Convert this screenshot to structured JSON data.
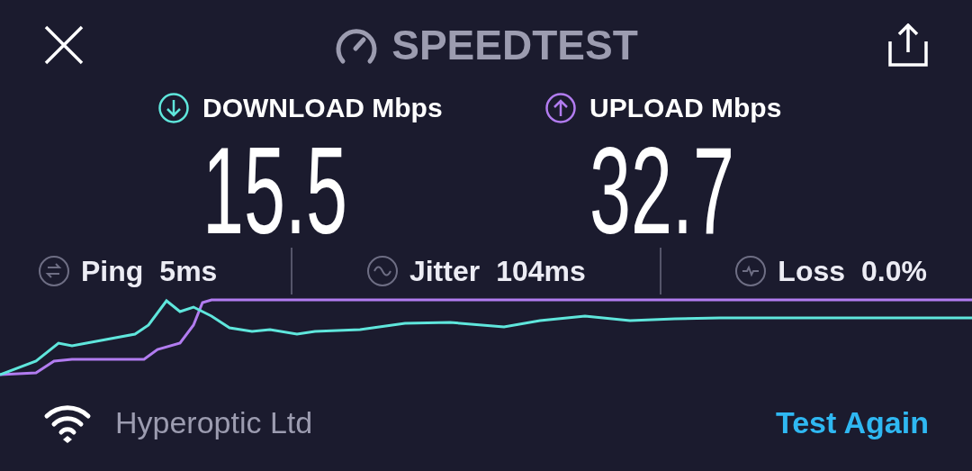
{
  "header": {
    "title": "SPEEDTEST"
  },
  "results": [
    {
      "kind": "download",
      "label": "DOWNLOAD Mbps",
      "value": "15.5",
      "color": "#5fe6dc"
    },
    {
      "kind": "upload",
      "label": "UPLOAD Mbps",
      "value": "32.7",
      "color": "#b27cf0"
    }
  ],
  "stats": [
    {
      "kind": "ping",
      "label": "Ping",
      "value": "5ms"
    },
    {
      "kind": "jitter",
      "label": "Jitter",
      "value": "104ms"
    },
    {
      "kind": "loss",
      "label": "Loss",
      "value": "0.0%"
    }
  ],
  "footer": {
    "provider": "Hyperoptic Ltd",
    "action": "Test Again"
  }
}
